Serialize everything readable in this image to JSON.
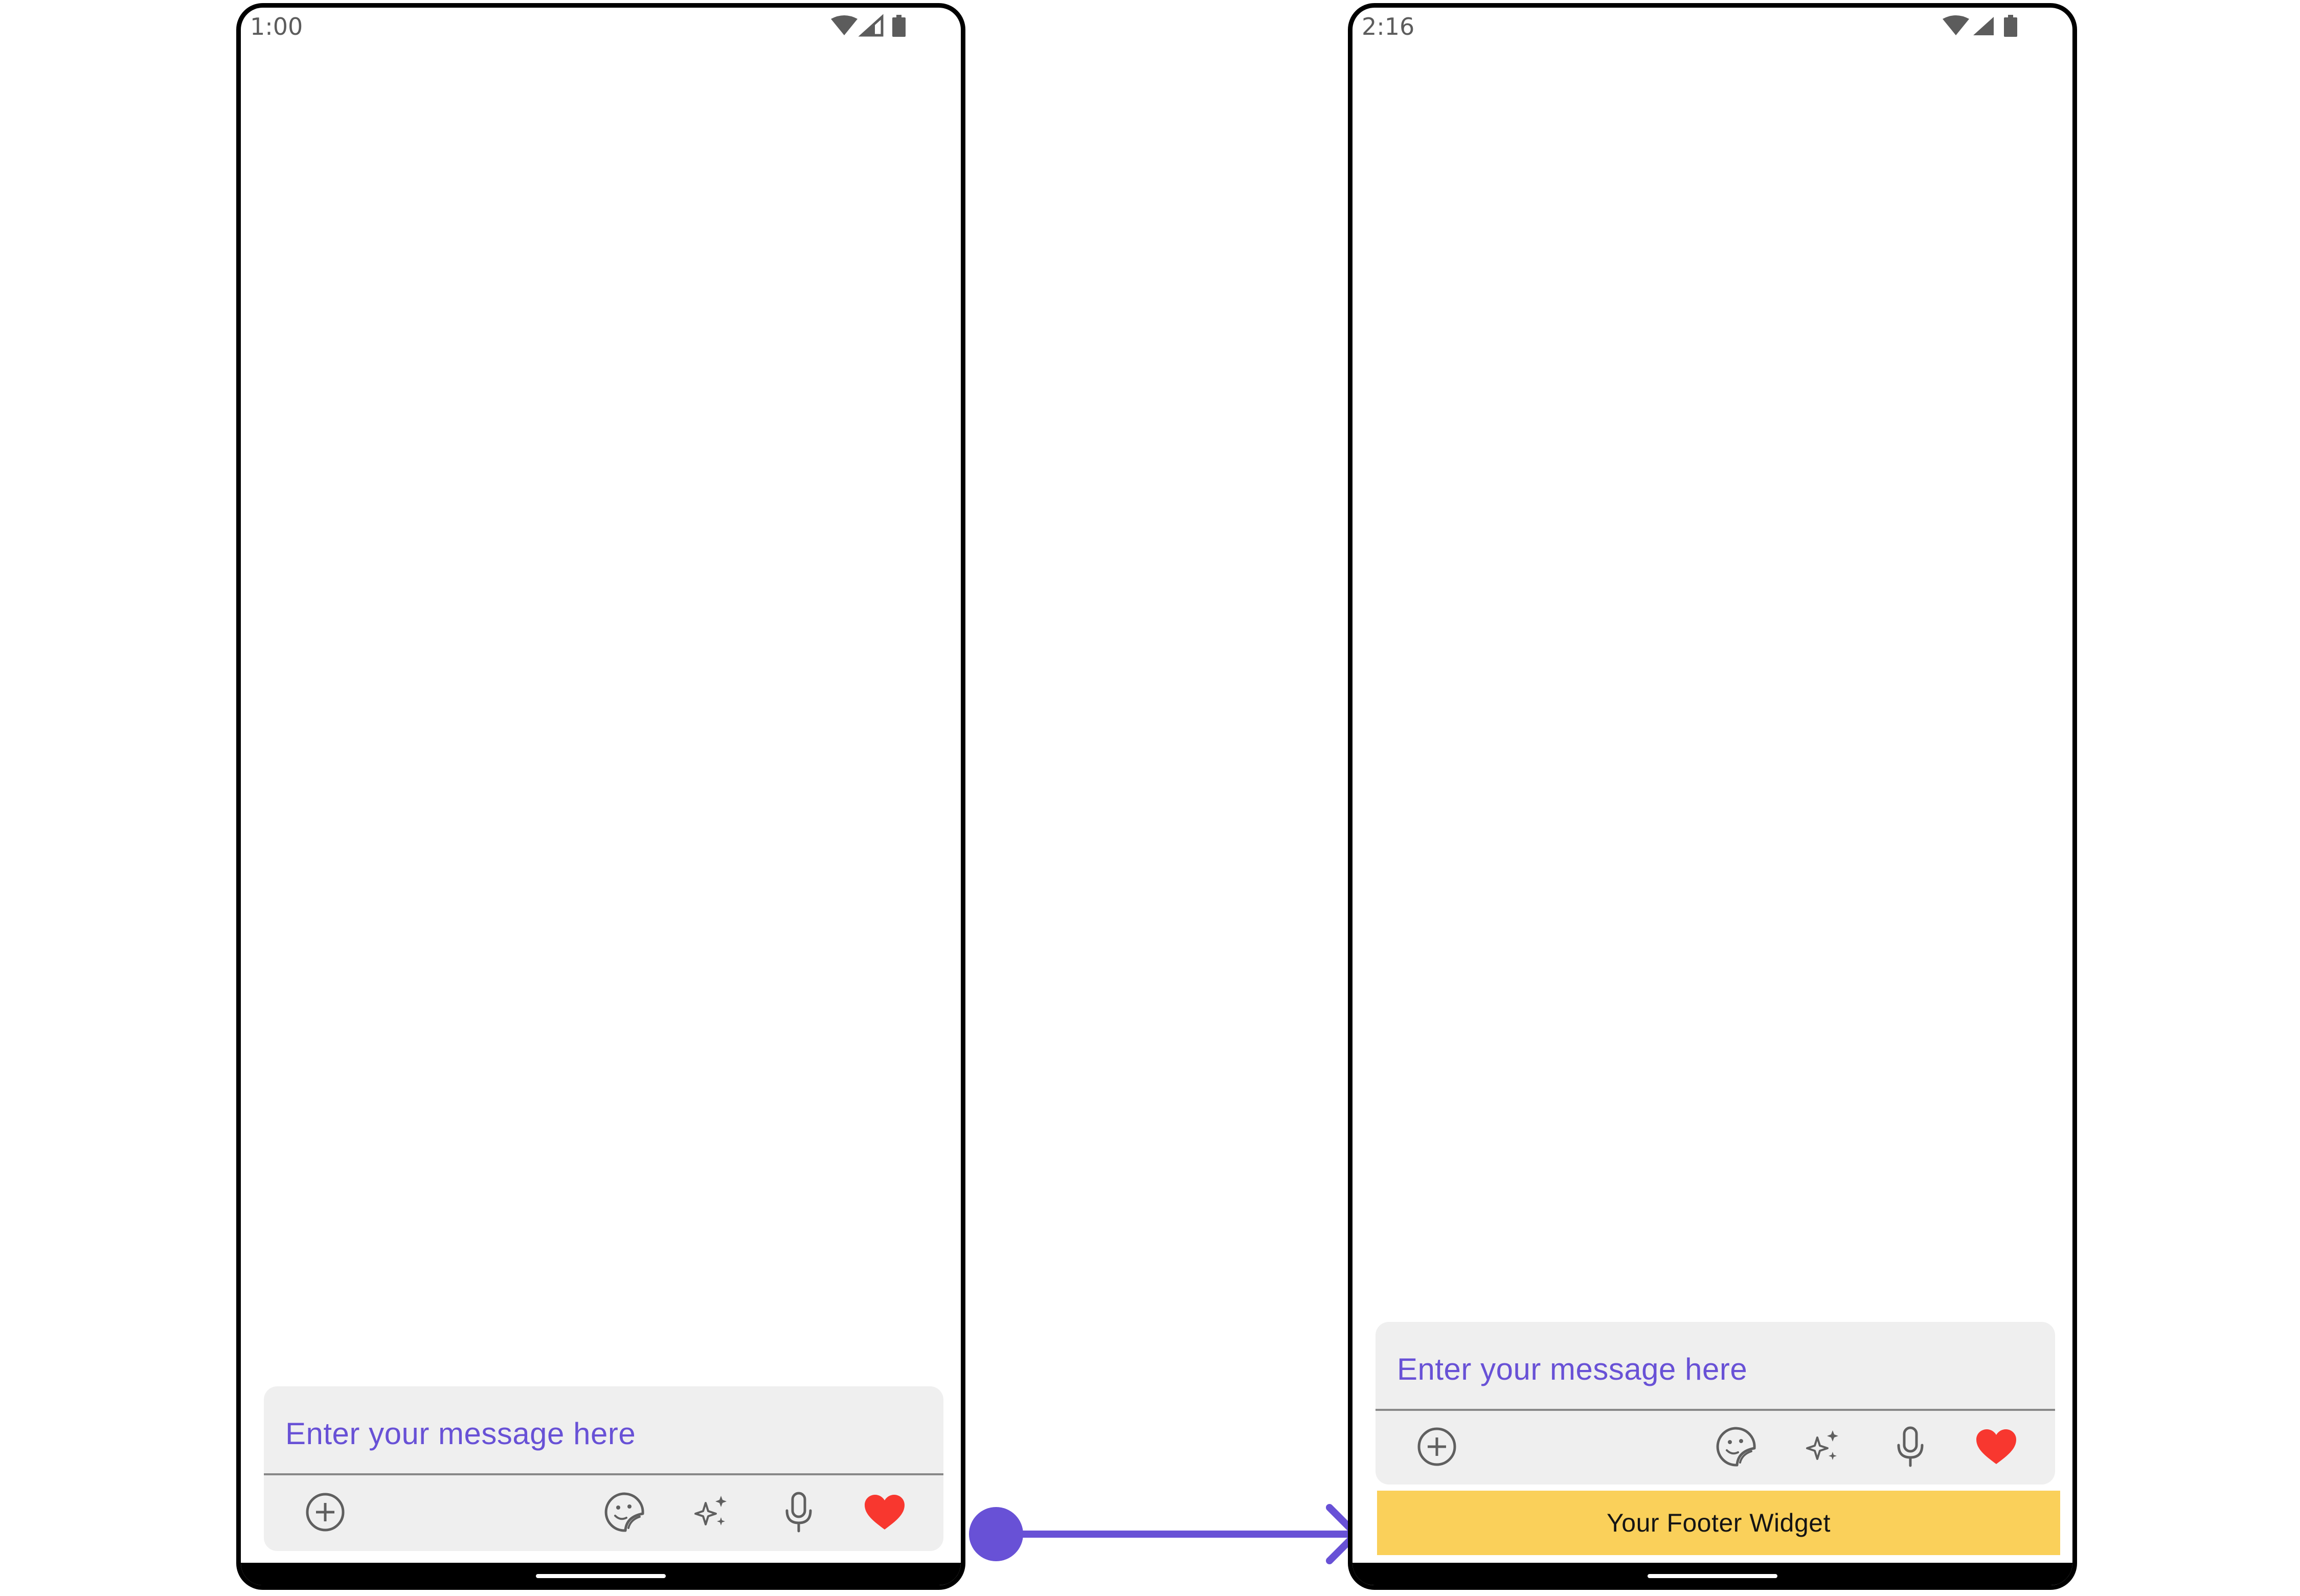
{
  "colors": {
    "accent": "#6851d6",
    "heart": "#f8372f",
    "footer_widget_bg": "#fad05a",
    "composer_bg": "#efefef",
    "icon_gray": "#5f5f5f",
    "frame": "#000000"
  },
  "screens": [
    {
      "status": {
        "time": "1:00",
        "icons": [
          "wifi-icon",
          "signal-icon",
          "battery-icon"
        ]
      },
      "composer": {
        "placeholder": "Enter your message here",
        "actions": [
          "add-attachment-icon",
          "sticker-icon",
          "ai-sparkle-icon",
          "microphone-icon",
          "heart-icon"
        ]
      }
    },
    {
      "status": {
        "time": "2:16",
        "icons": [
          "wifi-icon",
          "signal-icon",
          "battery-icon"
        ]
      },
      "composer": {
        "placeholder": "Enter your message here",
        "actions": [
          "add-attachment-icon",
          "sticker-icon",
          "ai-sparkle-icon",
          "microphone-icon",
          "heart-icon"
        ]
      },
      "footer_widget": {
        "label": "Your Footer Widget"
      }
    }
  ]
}
